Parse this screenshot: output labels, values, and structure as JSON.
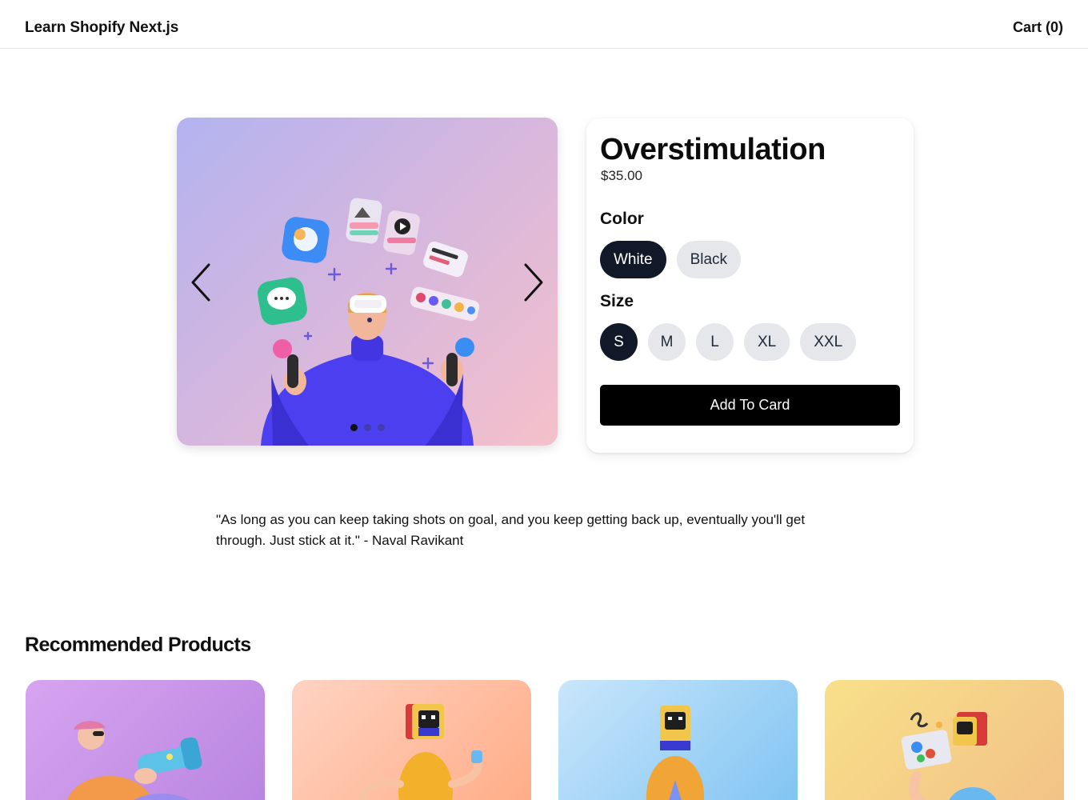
{
  "header": {
    "brand": "Learn Shopify Next.js",
    "cart_label": "Cart (0)"
  },
  "carousel": {
    "slide_count": 3,
    "active_slide": 1
  },
  "product": {
    "title": "Overstimulation",
    "price": "$35.00",
    "color_label": "Color",
    "colors": [
      "White",
      "Black"
    ],
    "selected_color": "White",
    "size_label": "Size",
    "sizes": [
      "S",
      "M",
      "L",
      "XL",
      "XXL"
    ],
    "selected_size": "S",
    "add_button_label": "Add To Card"
  },
  "quote": "\"As long as you can keep taking shots on goal, and you keep getting back up, eventually you'll get through. Just stick at it.\" - Naval Ravikant",
  "recommended": {
    "heading": "Recommended Products"
  },
  "colors": {
    "selected_pill": "#111827",
    "unselected_pill": "#e5e7eb",
    "button": "#000000"
  }
}
